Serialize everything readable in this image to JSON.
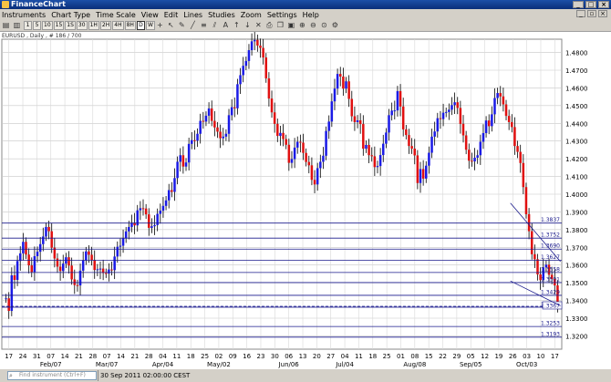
{
  "window": {
    "title": "FinanceChart"
  },
  "menu": [
    "Instruments",
    "Chart Type",
    "Time Scale",
    "View",
    "Edit",
    "Lines",
    "Studies",
    "Zoom",
    "Settings",
    "Help"
  ],
  "toolbar": {
    "timeframes": [
      "1",
      "5",
      "10",
      "15",
      "1S",
      "30",
      "1H",
      "2H",
      "4H",
      "8H",
      "D",
      "W"
    ],
    "active_timeframe": "D"
  },
  "chart": {
    "info": "EURUSD , Daily , # 186 / 700",
    "y_ticks": [
      "1.4800",
      "1.4700",
      "1.4600",
      "1.4500",
      "1.4400",
      "1.4300",
      "1.4200",
      "1.4100",
      "1.4000",
      "1.3900",
      "1.3800",
      "1.3700",
      "1.3600",
      "1.3500",
      "1.3400",
      "1.3300",
      "1.3200"
    ],
    "h_levels": [
      "1.3837",
      "1.3752",
      "1.3690",
      "1.3627",
      "1.3558",
      "1.3501",
      "1.3429",
      "1.3362",
      "1.3253",
      "1.3193"
    ],
    "current_price": "1.3367",
    "x_days": [
      "17",
      "24",
      "31",
      "07",
      "14",
      "21",
      "28",
      "07",
      "14",
      "21",
      "28",
      "04",
      "11",
      "18",
      "25",
      "02",
      "09",
      "16",
      "23",
      "30",
      "06",
      "13",
      "20",
      "27",
      "04",
      "11",
      "18",
      "25",
      "01",
      "08",
      "15",
      "22",
      "29",
      "05",
      "12",
      "19",
      "26",
      "03",
      "10",
      "17"
    ],
    "x_months": [
      [
        "Feb/07",
        3
      ],
      [
        "Mar/07",
        7
      ],
      [
        "Apr/04",
        11
      ],
      [
        "May/02",
        15
      ],
      [
        "Jun/06",
        20
      ],
      [
        "Jul/04",
        24
      ],
      [
        "Aug/08",
        29
      ],
      [
        "Sep/05",
        33
      ],
      [
        "Oct/03",
        37
      ]
    ],
    "colors": {
      "up": "#1a1ae6",
      "down": "#e01010",
      "level": "#1a1a8c"
    }
  },
  "chart_data": {
    "type": "candlestick",
    "ylim": [
      1.3125,
      1.4875
    ],
    "closes": [
      1.3412,
      1.3341,
      1.3542,
      1.3516,
      1.3623,
      1.3666,
      1.3731,
      1.3659,
      1.3598,
      1.3561,
      1.365,
      1.3675,
      1.3718,
      1.3761,
      1.3815,
      1.3791,
      1.3698,
      1.3637,
      1.3591,
      1.3566,
      1.3608,
      1.3644,
      1.3597,
      1.3519,
      1.3487,
      1.3485,
      1.3568,
      1.3626,
      1.3677,
      1.3658,
      1.3628,
      1.3572,
      1.3576,
      1.358,
      1.3555,
      1.3552,
      1.3575,
      1.3571,
      1.3648,
      1.3703,
      1.3709,
      1.375,
      1.379,
      1.3815,
      1.3839,
      1.3824,
      1.3909,
      1.3921,
      1.3919,
      1.3886,
      1.381,
      1.3819,
      1.3826,
      1.3889,
      1.3907,
      1.3934,
      1.3965,
      1.4023,
      1.4013,
      1.4091,
      1.4183,
      1.422,
      1.4156,
      1.4179,
      1.4284,
      1.4305,
      1.4302,
      1.4341,
      1.4414,
      1.441,
      1.4443,
      1.4484,
      1.4414,
      1.4377,
      1.4353,
      1.4316,
      1.4325,
      1.4341,
      1.4446,
      1.4491,
      1.4485,
      1.4621,
      1.4672,
      1.4725,
      1.4752,
      1.4813,
      1.4863,
      1.4871,
      1.4839,
      1.4826,
      1.4772,
      1.4654,
      1.454,
      1.4462,
      1.4397,
      1.4329,
      1.4346,
      1.4311,
      1.4279,
      1.4177,
      1.4198,
      1.4263,
      1.4296,
      1.4291,
      1.4233,
      1.4182,
      1.4163,
      1.4081,
      1.4055,
      1.4147,
      1.4183,
      1.4217,
      1.4357,
      1.441,
      1.4524,
      1.4596,
      1.4679,
      1.4664,
      1.4596,
      1.4637,
      1.4538,
      1.444,
      1.4407,
      1.4417,
      1.4396,
      1.4257,
      1.4278,
      1.422,
      1.4214,
      1.4153,
      1.4159,
      1.4221,
      1.4285,
      1.4348,
      1.4446,
      1.4472,
      1.4473,
      1.4582,
      1.4495,
      1.4366,
      1.4334,
      1.4272,
      1.4257,
      1.4219,
      1.4063,
      1.4142,
      1.4088,
      1.4161,
      1.4234,
      1.4325,
      1.4354,
      1.4429,
      1.4424,
      1.446,
      1.4464,
      1.4477,
      1.4503,
      1.4519,
      1.4487,
      1.4397,
      1.4332,
      1.4251,
      1.4189,
      1.4185,
      1.4206,
      1.422,
      1.4296,
      1.4345,
      1.4416,
      1.4384,
      1.4451,
      1.4543,
      1.4571,
      1.4552,
      1.4507,
      1.4442,
      1.4407,
      1.4379,
      1.4272,
      1.4239,
      1.4176,
      1.404,
      1.3887,
      1.3791,
      1.3661,
      1.3633,
      1.3547,
      1.3515,
      1.3587,
      1.3602,
      1.3545,
      1.3521,
      1.3485,
      1.3367
    ],
    "last_close": 1.3367
  }
}
